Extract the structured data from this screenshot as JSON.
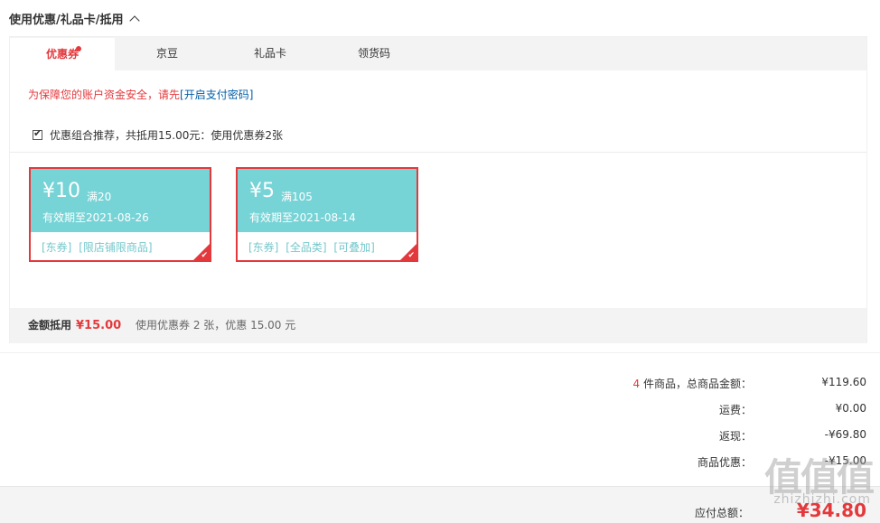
{
  "section": {
    "title": "使用优惠/礼品卡/抵用"
  },
  "tabs": [
    {
      "label": "优惠券"
    },
    {
      "label": "京豆"
    },
    {
      "label": "礼品卡"
    },
    {
      "label": "领货码"
    }
  ],
  "security": {
    "text": "为保障您的账户资金安全，请先",
    "link": "[开启支付密码]"
  },
  "combo": {
    "text": "优惠组合推荐，共抵用15.00元：使用优惠券2张"
  },
  "coupons": [
    {
      "amount": "¥10",
      "condition": "满20",
      "valid": "有效期至2021-08-26",
      "tags": [
        "[东券]",
        "[限店铺限商品]"
      ]
    },
    {
      "amount": "¥5",
      "condition": "满105",
      "valid": "有效期至2021-08-14",
      "tags": [
        "[东券]",
        "[全品类]",
        "[可叠加]"
      ]
    }
  ],
  "summary": {
    "label": "金额抵用",
    "amount": "¥15.00",
    "desc": "使用优惠券 2 张，优惠 15.00 元"
  },
  "totals": {
    "item_count": "4",
    "items_label": " 件商品，总商品金额：",
    "items_value": "¥119.60",
    "shipping_label": "运费：",
    "shipping_value": "¥0.00",
    "rebate_label": "返现：",
    "rebate_value": "-¥69.80",
    "discount_label": "商品优惠：",
    "discount_value": "-¥15.00",
    "payable_label": "应付总额：",
    "payable_value": "¥34.80"
  },
  "watermark": {
    "logo": "值值值",
    "site": "zhizhizhi.com"
  },
  "colors": {
    "accent": "#e4393c",
    "coupon": "#76d3d6",
    "link": "#005ea7"
  }
}
